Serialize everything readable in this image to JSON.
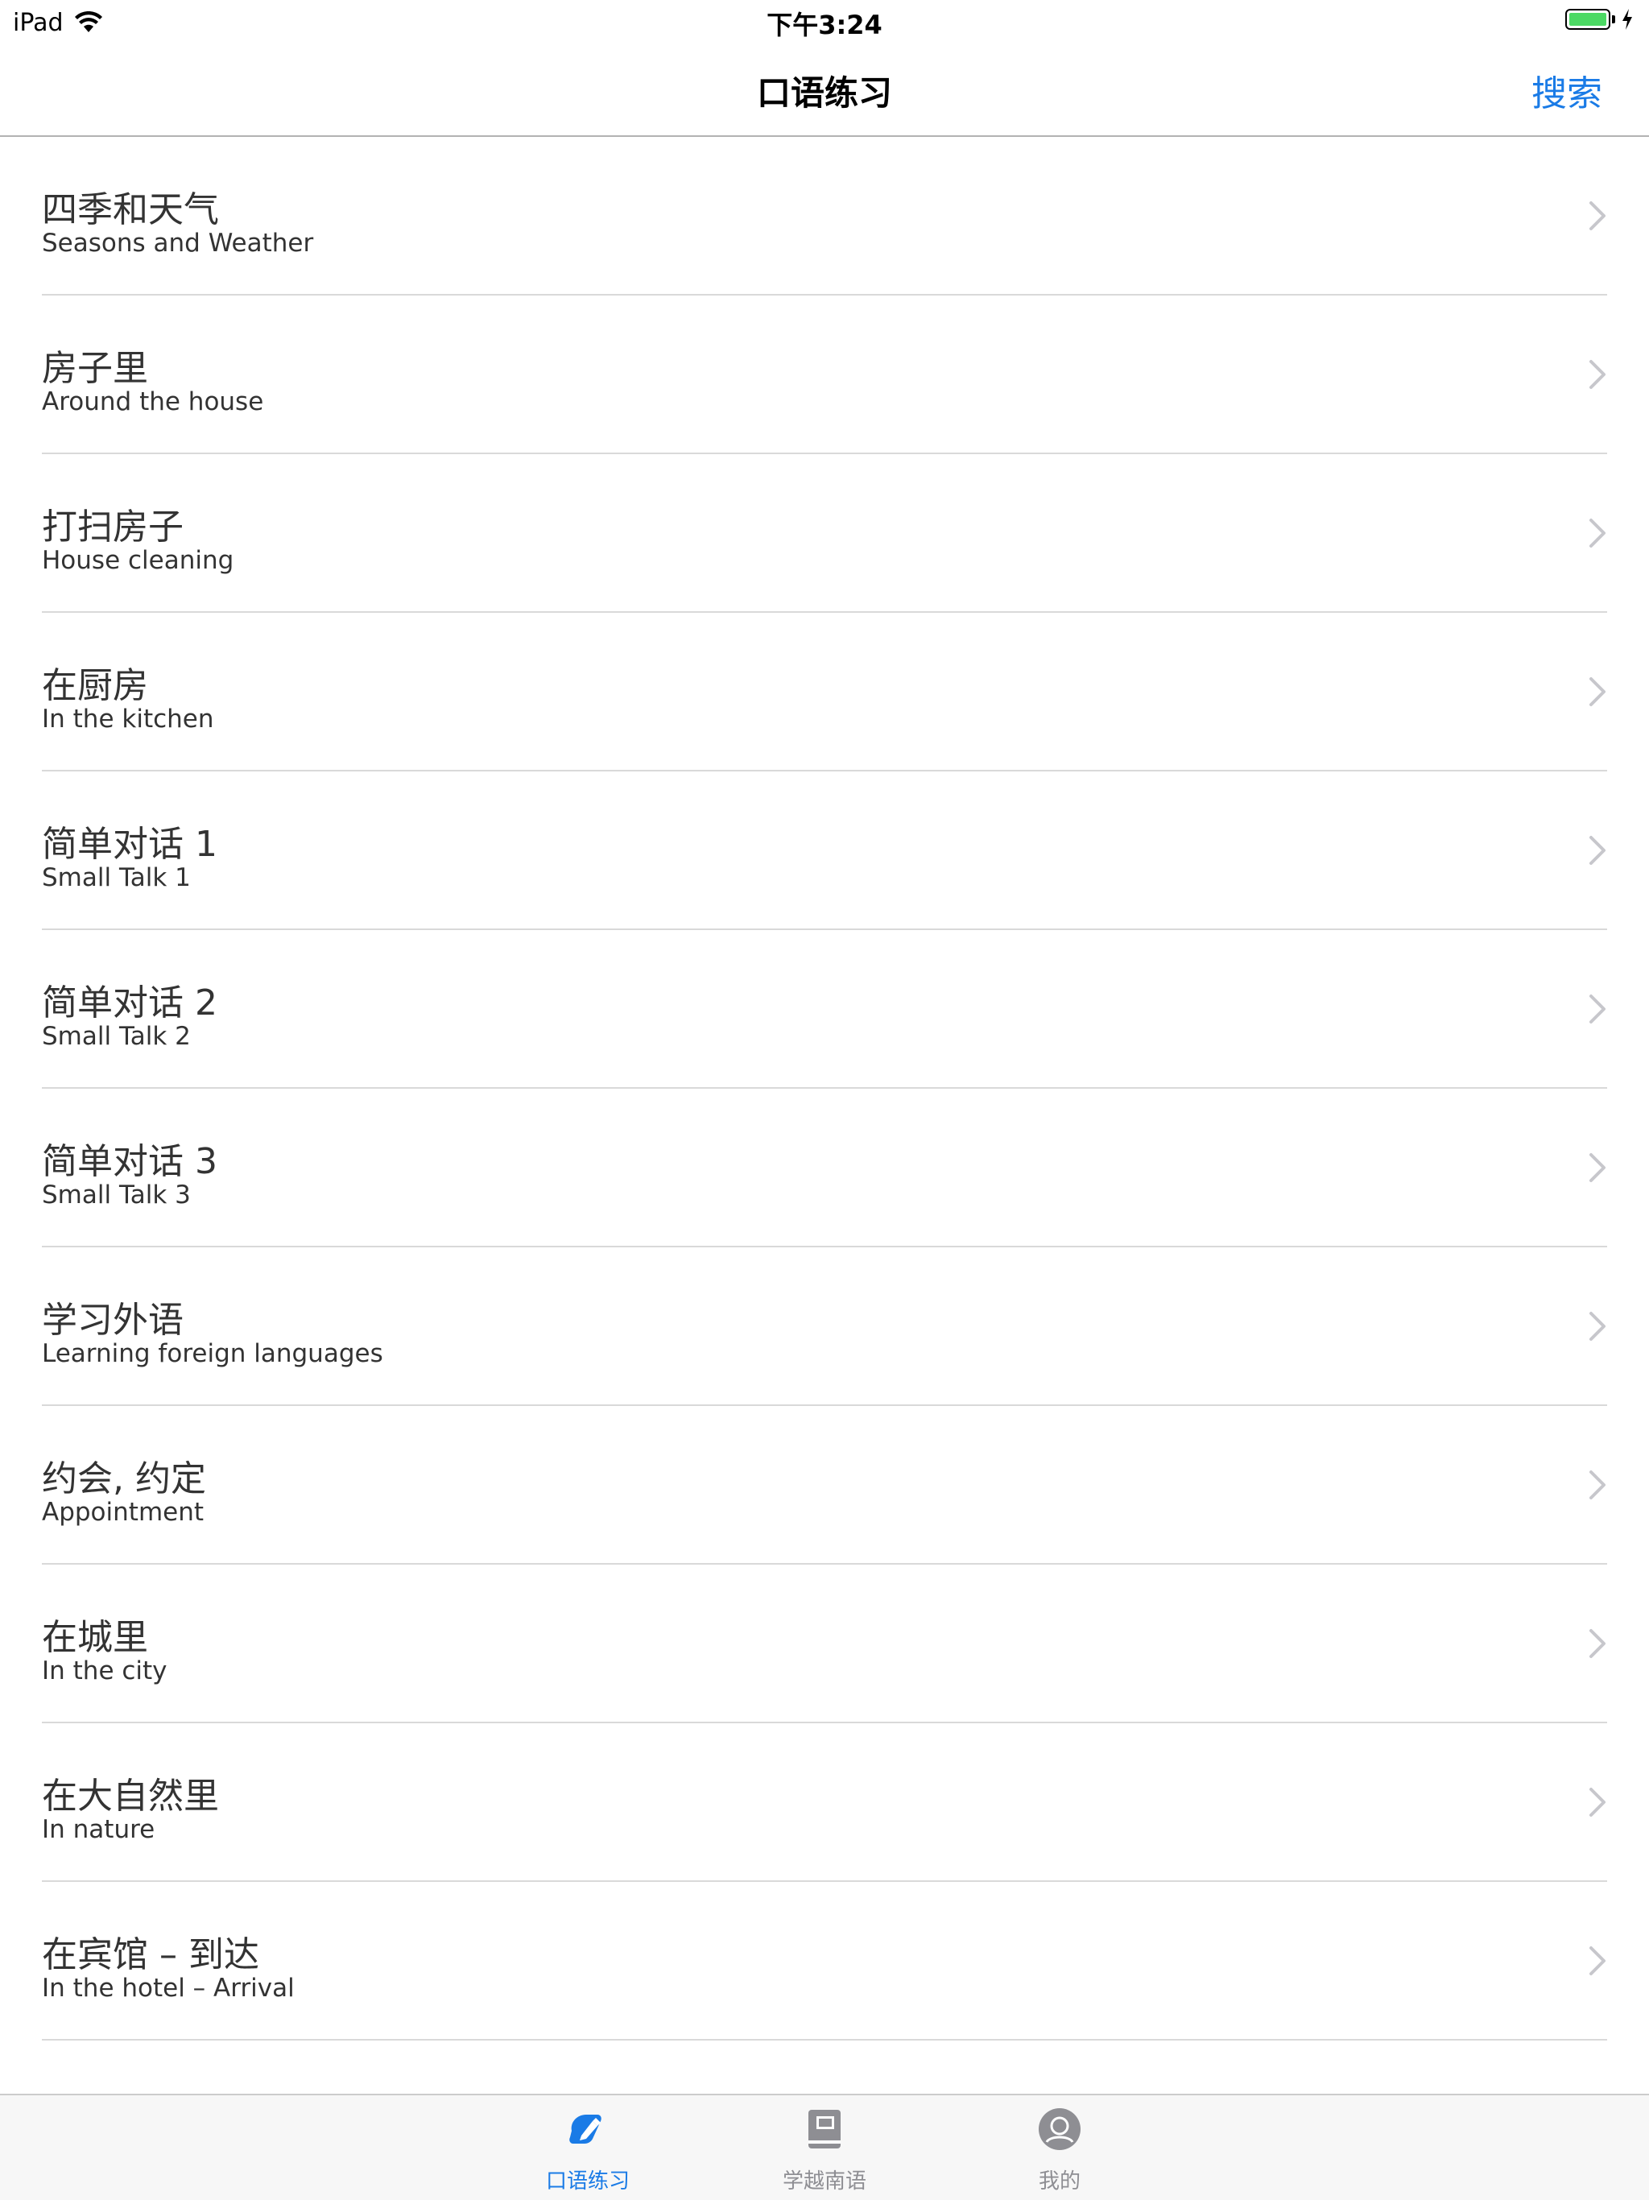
{
  "status_bar": {
    "device": "iPad",
    "time": "下午3:24",
    "battery_color": "#4cd964"
  },
  "nav": {
    "title": "口语练习",
    "search_label": "搜索"
  },
  "accent_color": "#1a7be6",
  "lessons": [
    {
      "title": "四季和天气",
      "subtitle": "Seasons and Weather"
    },
    {
      "title": "房子里",
      "subtitle": "Around the house"
    },
    {
      "title": "打扫房子",
      "subtitle": "House cleaning"
    },
    {
      "title": "在厨房",
      "subtitle": "In the kitchen"
    },
    {
      "title": "简单对话 1",
      "subtitle": "Small Talk 1"
    },
    {
      "title": "简单对话 2",
      "subtitle": "Small Talk 2"
    },
    {
      "title": "简单对话 3",
      "subtitle": "Small Talk 3"
    },
    {
      "title": "学习外语",
      "subtitle": "Learning foreign languages"
    },
    {
      "title": "约会, 约定",
      "subtitle": "Appointment"
    },
    {
      "title": "在城里",
      "subtitle": "In the city"
    },
    {
      "title": "在大自然里",
      "subtitle": "In nature"
    },
    {
      "title": "在宾馆 – 到达",
      "subtitle": "In the hotel – Arrival"
    }
  ],
  "tabs": [
    {
      "label": "口语练习",
      "icon": "pencil-icon",
      "active": true
    },
    {
      "label": "学越南语",
      "icon": "book-icon",
      "active": false
    },
    {
      "label": "我的",
      "icon": "profile-icon",
      "active": false
    }
  ]
}
